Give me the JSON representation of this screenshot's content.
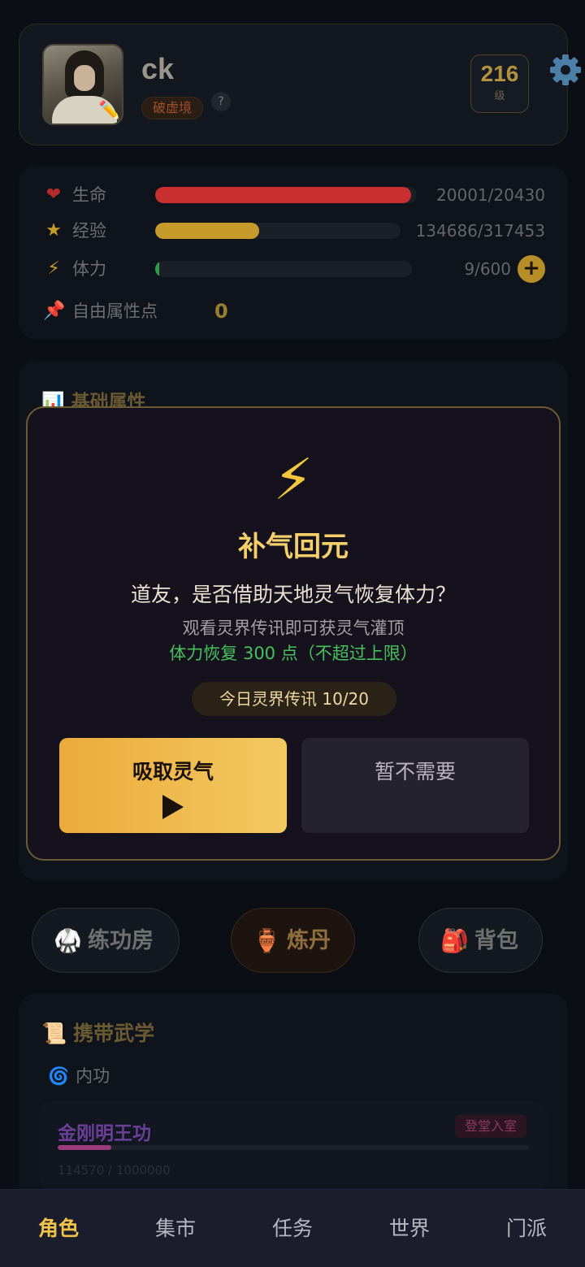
{
  "profile": {
    "name": "ck",
    "realm": "破虚境",
    "realm_help": "?",
    "level": "216",
    "level_unit": "级"
  },
  "stats": {
    "hp": {
      "icon": "❤",
      "label": "生命",
      "value": "20001/20430",
      "ratio": 0.979,
      "color": "#c8302f"
    },
    "exp": {
      "icon": "★",
      "label": "经验",
      "value": "134686/317453",
      "ratio": 0.424,
      "color": "#c79a2c"
    },
    "stamina": {
      "icon": "⚡",
      "label": "体力",
      "value": "9/600",
      "ratio": 0.015,
      "color": "#2f9a4a",
      "add": "+"
    },
    "free_points": {
      "icon": "📌",
      "label": "自由属性点",
      "value": "0"
    }
  },
  "base_attrs": {
    "icon": "📊",
    "title": "基础属性"
  },
  "modal": {
    "icon": "⚡",
    "title": "补气回元",
    "question": "道友，是否借助天地灵气恢复体力？",
    "desc": "观看灵界传讯即可获灵气灌顶",
    "reward": "体力恢复 300 点（不超过上限）",
    "quota": "今日灵界传讯 10/20",
    "confirm_label": "吸取灵气",
    "cancel_label": "暂不需要"
  },
  "actions": {
    "train": {
      "icon": "🥋",
      "label": "练功房"
    },
    "alchemy": {
      "icon": "🏺",
      "label": "炼丹"
    },
    "bag": {
      "icon": "🎒",
      "label": "背包"
    }
  },
  "martial": {
    "icon": "📜",
    "title": "携带武学",
    "inner_icon": "🌀",
    "inner_label": "内功",
    "skill": {
      "name": "金刚明王功",
      "tag": "登堂入室",
      "progress_text": "114570 / 1000000",
      "ratio": 0.1146
    }
  },
  "nav": {
    "items": [
      "角色",
      "集市",
      "任务",
      "世界",
      "门派"
    ],
    "active": "角色"
  }
}
